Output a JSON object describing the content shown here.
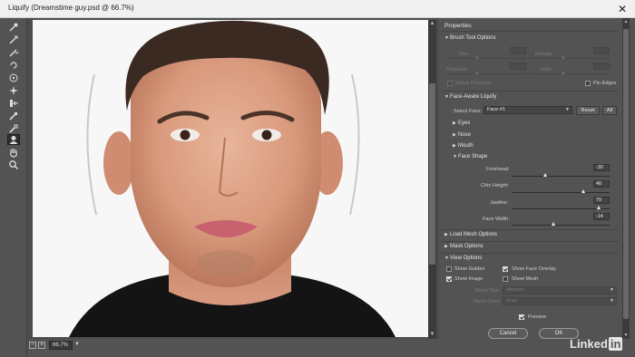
{
  "window": {
    "title": "Liquify (Dreamstime guy.psd @ 66.7%)",
    "close_label": "✕"
  },
  "toolbar": {
    "tools": [
      {
        "name": "forward-warp-tool-icon"
      },
      {
        "name": "reconstruct-tool-icon"
      },
      {
        "name": "smooth-tool-icon"
      },
      {
        "name": "twirl-clockwise-tool-icon"
      },
      {
        "name": "pucker-tool-icon"
      },
      {
        "name": "bloat-tool-icon"
      },
      {
        "name": "push-left-tool-icon"
      },
      {
        "name": "freeze-mask-tool-icon"
      },
      {
        "name": "thaw-mask-tool-icon"
      },
      {
        "name": "face-tool-icon"
      },
      {
        "name": "hand-tool-icon"
      },
      {
        "name": "zoom-tool-icon"
      }
    ]
  },
  "status": {
    "zoom": "66.7%",
    "zoom_out": "−",
    "zoom_in": "+"
  },
  "panel": {
    "title": "Properties",
    "brush_tool_options": {
      "header": "Brush Tool Options",
      "size_label": "Size:",
      "density_label": "Density:",
      "pressure_label": "Pressure:",
      "rate_label": "Rate:",
      "stylus_pressure_label": "Stylus Pressure",
      "pin_edges_label": "Pin Edges"
    },
    "face_aware": {
      "header": "Face-Aware Liquify",
      "select_face_label": "Select Face:",
      "select_face_value": "Face #1",
      "reset_label": "Reset",
      "all_label": "All",
      "eyes": "Eyes",
      "nose": "Nose",
      "mouth": "Mouth",
      "face_shape": "Face Shape",
      "forehead_label": "Forehead:",
      "forehead_value": "-30",
      "chin_height_label": "Chin Height:",
      "chin_height_value": "48",
      "jawline_label": "Jawline:",
      "jawline_value": "79",
      "face_width_label": "Face Width:",
      "face_width_value": "-14",
      "slider_levels": {
        "forehead": -30,
        "chin_height": 48,
        "jawline": 79,
        "face_width": -14,
        "range": [
          -100,
          100
        ]
      }
    },
    "load_mesh_options": "Load Mesh Options",
    "mask_options": "Mask Options",
    "view_options": {
      "header": "View Options",
      "show_guides": "Show Guides",
      "show_face_overlay": "Show Face Overlay",
      "show_image": "Show Image",
      "show_mesh": "Show Mesh",
      "mesh_size_label": "Mesh Size:",
      "mesh_size_value": "Medium",
      "mesh_color_label": "Mesh Color:",
      "mesh_color_value": "Gray",
      "checked": {
        "show_guides": false,
        "show_face_overlay": true,
        "show_image": true,
        "show_mesh": false
      }
    },
    "preview_label": "Preview",
    "cancel_label": "Cancel",
    "ok_label": "OK"
  },
  "watermark": {
    "text": "Linked",
    "in": "in"
  },
  "colors": {
    "panel_bg": "#535353",
    "dark_track": "#2b2b2b",
    "text": "#d8d8d8"
  }
}
